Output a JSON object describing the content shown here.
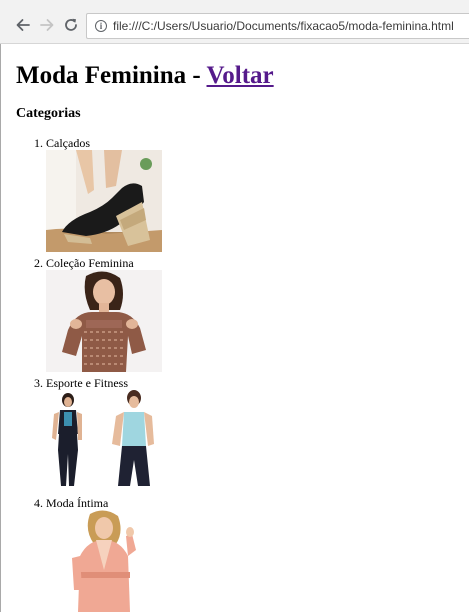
{
  "browser": {
    "url": "file:///C:/Users/Usuario/Documents/fixacao5/moda-feminina.html"
  },
  "page": {
    "title": "Moda Feminina - ",
    "back_link": "Voltar",
    "section_heading": "Categorias",
    "categories": [
      {
        "label": "Calçados",
        "image": "shoe-photo"
      },
      {
        "label": "Coleção Feminina",
        "image": "blouse-photo"
      },
      {
        "label": "Esporte e Fitness",
        "image": "fitness-photo"
      },
      {
        "label": "Moda Íntima",
        "image": "robe-photo"
      }
    ]
  },
  "colors": {
    "link_visited": "#551a8b",
    "toolbar_bg": "#f2f2f2"
  }
}
